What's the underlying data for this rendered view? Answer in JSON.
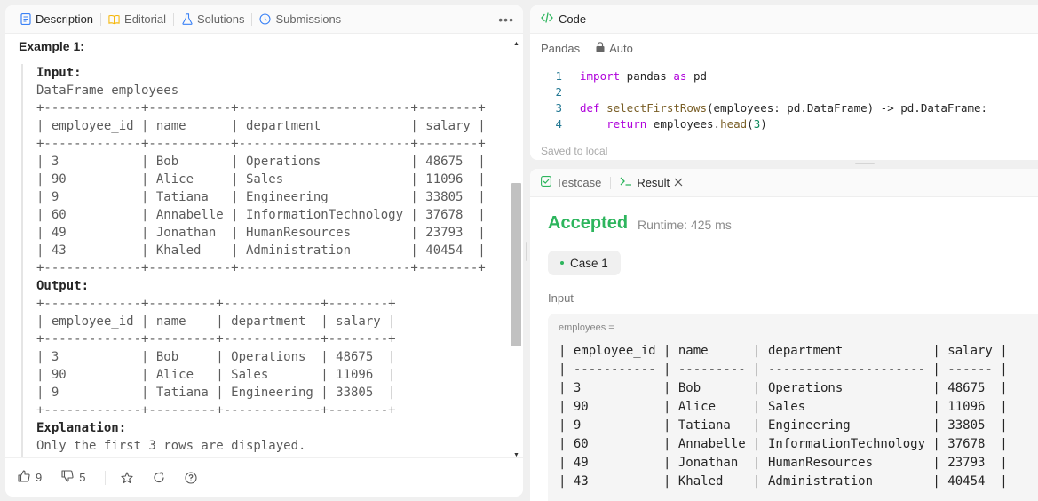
{
  "left_tabs": {
    "description": "Description",
    "editorial": "Editorial",
    "solutions": "Solutions",
    "submissions": "Submissions"
  },
  "example": {
    "title": "Example 1:",
    "input_label": "Input:",
    "dataframe_name": "DataFrame employees",
    "input_table": [
      "+-------------+-----------+-----------------------+--------+",
      "| employee_id | name      | department            | salary |",
      "+-------------+-----------+-----------------------+--------+",
      "| 3           | Bob       | Operations            | 48675  |",
      "| 90          | Alice     | Sales                 | 11096  |",
      "| 9           | Tatiana   | Engineering           | 33805  |",
      "| 60          | Annabelle | InformationTechnology | 37678  |",
      "| 49          | Jonathan  | HumanResources        | 23793  |",
      "| 43          | Khaled    | Administration        | 40454  |",
      "+-------------+-----------+-----------------------+--------+"
    ],
    "output_label": "Output:",
    "output_table": [
      "+-------------+---------+-------------+--------+",
      "| employee_id | name    | department  | salary |",
      "+-------------+---------+-------------+--------+",
      "| 3           | Bob     | Operations  | 48675  |",
      "| 90          | Alice   | Sales       | 11096  |",
      "| 9           | Tatiana | Engineering | 33805  |",
      "+-------------+---------+-------------+--------+"
    ],
    "explanation_label": "Explanation:",
    "explanation_text": "Only the first 3 rows are displayed."
  },
  "footer": {
    "likes": "9",
    "dislikes": "5"
  },
  "code": {
    "header": "Code",
    "language": "Pandas",
    "mode": "Auto",
    "saved": "Saved to local",
    "line_numbers": [
      "1",
      "2",
      "3",
      "4"
    ]
  },
  "result": {
    "testcase_tab": "Testcase",
    "result_tab": "Result",
    "status": "Accepted",
    "runtime": "Runtime: 425 ms",
    "case": "Case 1",
    "input_label": "Input",
    "var_label": "employees =",
    "rows": [
      "| employee_id | name      | department            | salary |",
      "| ----------- | --------- | --------------------- | ------ |",
      "| 3           | Bob       | Operations            | 48675  |",
      "| 90          | Alice     | Sales                 | 11096  |",
      "| 9           | Tatiana   | Engineering           | 33805  |",
      "| 60          | Annabelle | InformationTechnology | 37678  |",
      "| 49          | Jonathan  | HumanResources        | 23793  |",
      "| 43          | Khaled    | Administration        | 40454  |"
    ]
  },
  "colors": {
    "accepted": "#2db55d",
    "keyword": "#af00db",
    "function": "#795e26",
    "number": "#098658"
  }
}
